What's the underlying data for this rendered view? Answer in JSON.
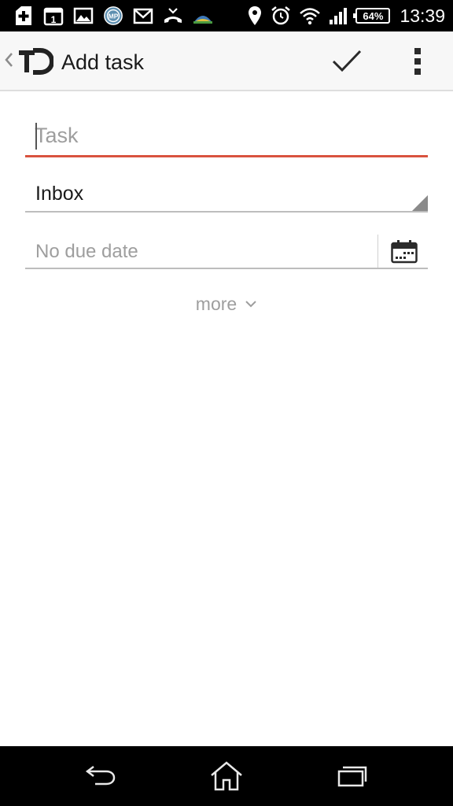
{
  "status_bar": {
    "notification_icons": [
      "add-notification-icon",
      "calendar-date-icon",
      "gallery-icon",
      "app-notification-icon",
      "gmail-icon",
      "missed-call-icon",
      "weather-app-icon"
    ],
    "calendar_day": "1",
    "app_badge": "MP",
    "system_icons": [
      "location-pin-icon",
      "alarm-clock-icon",
      "wifi-icon",
      "cell-signal-icon",
      "battery-icon"
    ],
    "battery_percent": "64%",
    "time": "13:39"
  },
  "app_bar": {
    "title": "Add task",
    "logo_icon": "todoist-logo-icon",
    "confirm_icon": "checkmark-icon",
    "overflow_icon": "more-vertical-icon"
  },
  "form": {
    "task": {
      "placeholder": "Task",
      "value": ""
    },
    "project": {
      "selected": "Inbox"
    },
    "due_date": {
      "placeholder": "No due date",
      "value": "",
      "icon": "calendar-icon"
    },
    "more_label": "more"
  },
  "nav_bar": {
    "back_icon": "back-arrow-icon",
    "home_icon": "home-icon",
    "recents_icon": "recent-apps-icon"
  },
  "colors": {
    "accent": "#d9533f",
    "appbar_bg": "#f7f7f7",
    "hint_text": "#9e9e9e",
    "system_bars": "#000000"
  }
}
